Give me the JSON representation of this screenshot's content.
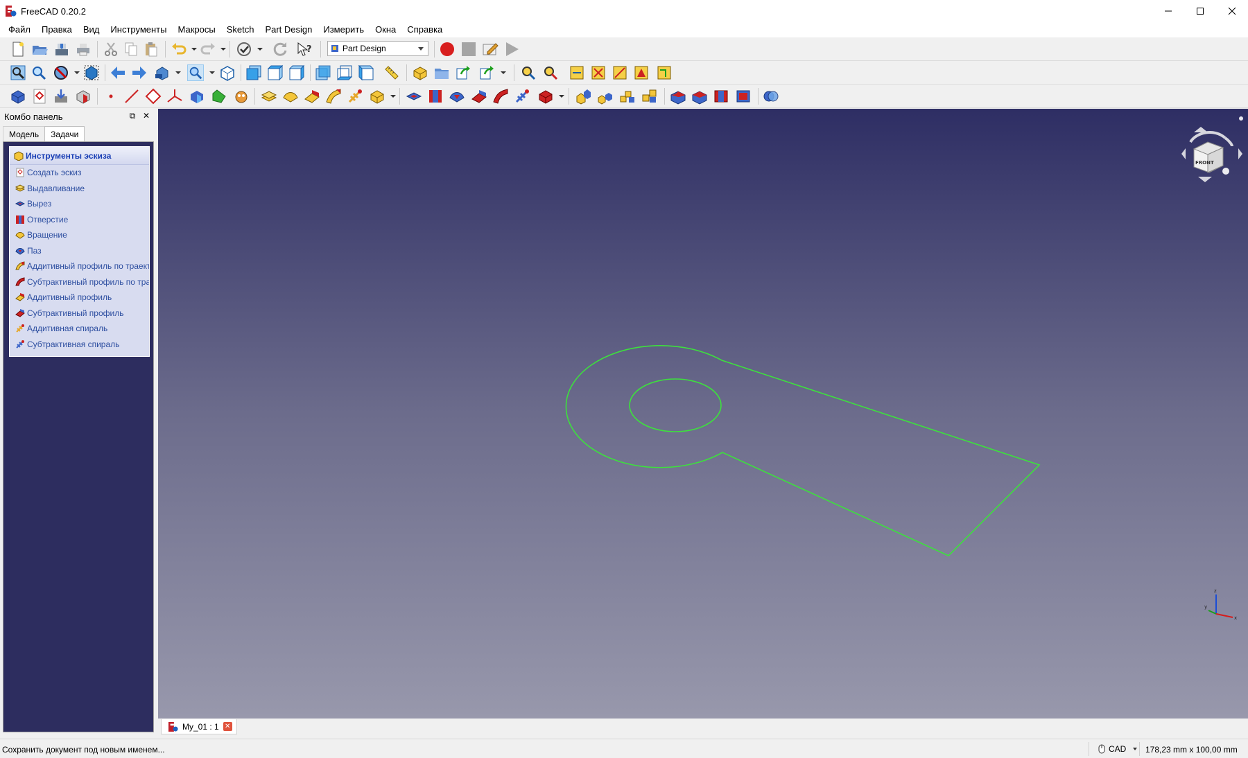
{
  "window": {
    "title": "FreeCAD 0.20.2",
    "controls": [
      "minimize",
      "maximize",
      "close"
    ]
  },
  "menu": {
    "items": [
      "Файл",
      "Правка",
      "Вид",
      "Инструменты",
      "Макросы",
      "Sketch",
      "Part Design",
      "Измерить",
      "Окна",
      "Справка"
    ]
  },
  "toolbar": {
    "workbench": "Part Design",
    "file_icons": [
      "new-document-icon",
      "open-icon",
      "save-icon",
      "print-icon",
      "cut-icon",
      "copy-icon",
      "paste-icon",
      "undo-icon",
      "redo-icon",
      "refresh-icon",
      "whats-this-icon"
    ],
    "macro_icons": [
      "macro-record-icon",
      "macro-stop-icon",
      "macro-edit-icon",
      "macro-run-icon"
    ]
  },
  "combo": {
    "title": "Комбо панель",
    "tabs": [
      "Модель",
      "Задачи"
    ],
    "active_tab": "Задачи",
    "taskbox_title": "Инструменты эскиза",
    "tasks": [
      "Создать эскиз",
      "Выдавливание",
      "Вырез",
      "Отверстие",
      "Вращение",
      "Паз",
      "Аддитивный профиль по траектории",
      "Субтрактивный профиль по траектории",
      "Аддитивный профиль",
      "Субтрактивный профиль",
      "Аддитивная спираль",
      "Субтрактивная спираль"
    ]
  },
  "view": {
    "sketch_color": "#3de03d",
    "navcube_label": "FRONT",
    "axes": [
      "x",
      "y",
      "z"
    ]
  },
  "document": {
    "tab_label": "My_01 : 1"
  },
  "status": {
    "message": "Сохранить документ под новым именем...",
    "navigation": "CAD",
    "dimensions": "178,23 mm x 100,00 mm"
  },
  "colors": {
    "view_top": "#2e2e64",
    "view_bottom": "#9898ac",
    "task_link": "#2d4ea0",
    "task_panel_bg": "#2d2d5f"
  }
}
